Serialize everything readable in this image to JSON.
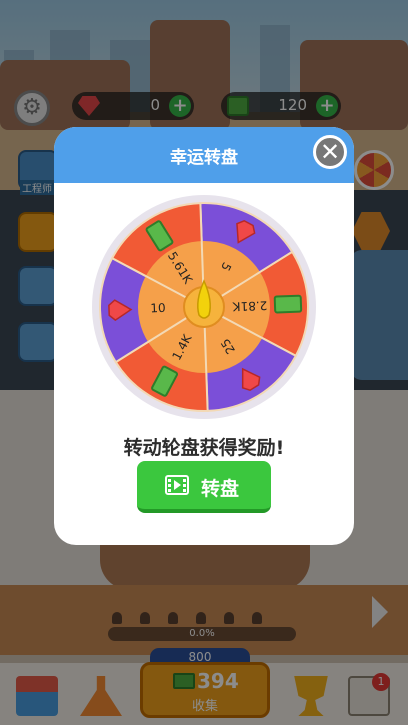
{
  "hud": {
    "gems": "0",
    "cash": "120"
  },
  "side": {
    "engineer_label": "工程师"
  },
  "modal": {
    "title": "幸运转盘",
    "instruction": "转动轮盘获得奖励!",
    "spin_label": "转盘",
    "close_icon": "close-icon"
  },
  "wheel": {
    "segments": [
      {
        "label": "5",
        "reward": "gem",
        "color": "#7b4fd8"
      },
      {
        "label": "2.81K",
        "reward": "cash",
        "color": "#f15a35"
      },
      {
        "label": "25",
        "reward": "gem",
        "color": "#7b4fd8"
      },
      {
        "label": "1.4K",
        "reward": "cash",
        "color": "#f15a35"
      },
      {
        "label": "10",
        "reward": "gem",
        "color": "#7b4fd8"
      },
      {
        "label": "5.61K",
        "reward": "cash",
        "color": "#f15a35"
      }
    ],
    "rim_color": "#e7e3ec",
    "inner_color": "#f5a04a",
    "hub_color": "#f6b33c",
    "pointer_color": "#f2d20c"
  },
  "footer": {
    "progress": "0.0%",
    "capacity": "800",
    "collect_amount": "394",
    "collect_label": "收集",
    "notification_count": "1"
  },
  "colors": {
    "header": "#4f9fea",
    "spin_button": "#3bc73e",
    "collect_button": "#f0a11d"
  }
}
